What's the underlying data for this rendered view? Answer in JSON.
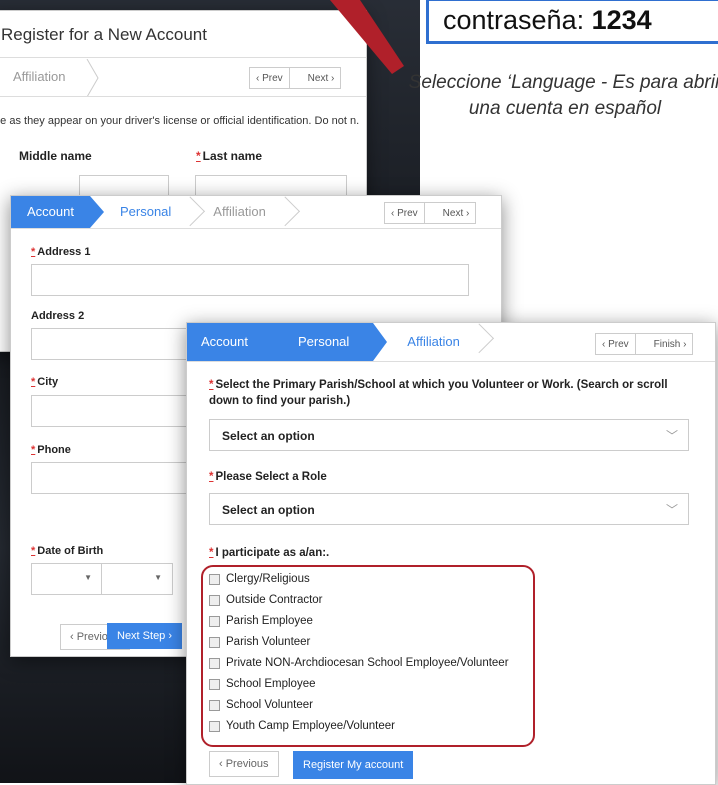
{
  "callout": {
    "text_prefix": "contraseña: ",
    "text_bold": "1234"
  },
  "note": "Seleccione  ‘Language - Es para abrir una cuenta en español",
  "win1": {
    "title": "Register for a New Account",
    "step": "Affiliation",
    "prev": "‹  Prev",
    "next": "Next  ›",
    "desc": "me as they appear on your driver's license or official identification. Do not n.",
    "middle_name": "Middle name",
    "last_name": "Last name"
  },
  "win2": {
    "tabs": [
      "Account",
      "Personal",
      "Affiliation"
    ],
    "prev": "‹  Prev",
    "next": "Next  ›",
    "address1": "Address 1",
    "address2": "Address 2",
    "city": "City",
    "phone": "Phone",
    "dob": "Date of Birth",
    "previous": "‹  Previous",
    "next_step": "Next Step  ›"
  },
  "win3": {
    "tabs": [
      "Account",
      "Personal",
      "Affiliation"
    ],
    "prev": "‹  Prev",
    "finish": "Finish  ›",
    "q1": "Select the Primary Parish/School at which you Volunteer or Work. (Search or scroll down to find your parish.)",
    "select1": "Select an option",
    "q2": "Please Select a Role",
    "select2": "Select an option",
    "q3": "I participate as a/an:.",
    "options": [
      "Clergy/Religious",
      "Outside Contractor",
      "Parish Employee",
      "Parish Volunteer",
      "Private NON-Archdiocesan School Employee/Volunteer",
      "School Employee",
      "School Volunteer",
      "Youth Camp Employee/Volunteer"
    ],
    "previous": "‹  Previous",
    "register": "Register My account"
  },
  "colors": {
    "accent": "#3a84e6",
    "highlight": "#b0202a",
    "callout_border": "#2f6fd0"
  }
}
